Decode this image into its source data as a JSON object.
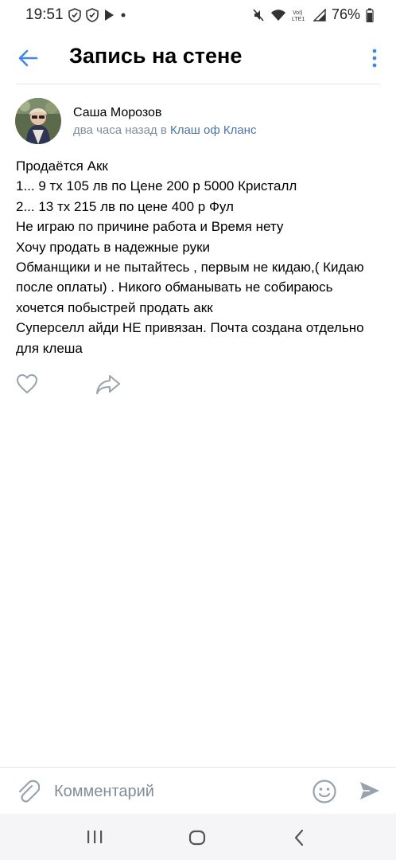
{
  "status_bar": {
    "time": "19:51",
    "battery": "76%",
    "left_icons": [
      "shield-icon",
      "shield-icon",
      "play-icon",
      "dot-icon"
    ],
    "right_icons": [
      "mute-icon",
      "wifi-icon",
      "volte-icon",
      "signal-icon",
      "battery-icon"
    ]
  },
  "header": {
    "title": "Запись на стене"
  },
  "post": {
    "author": "Саша Морозов",
    "time": "два часа назад в",
    "group": "Клаш оф Кланс",
    "lines": [
      "Продаётся   Акк",
      "1... 9 тх 105 лв по Цене 200 р 5000 Кристалл",
      "2... 13 тх 215 лв по цене 400 р Фул",
      "Не играю по причине работа и Время нету",
      "Хочу продать в надежные руки",
      "Обманщики и не пытайтесь , первым не кидаю,( Кидаю",
      "после оплаты) . Никого обманывать не собираюсь",
      "хочется побыстрей продать акк",
      "Суперселл айди НЕ привязан. Почта создана отдельно",
      "для клеша"
    ]
  },
  "actions": {
    "icons": [
      "heart-icon",
      "share-icon"
    ]
  },
  "comment_bar": {
    "placeholder": "Комментарий",
    "value": ""
  },
  "colors": {
    "accent": "#4a76a8",
    "icon_gray": "#99a2ad",
    "meta_gray": "#818c99",
    "back_blue": "#3f8ae0"
  }
}
